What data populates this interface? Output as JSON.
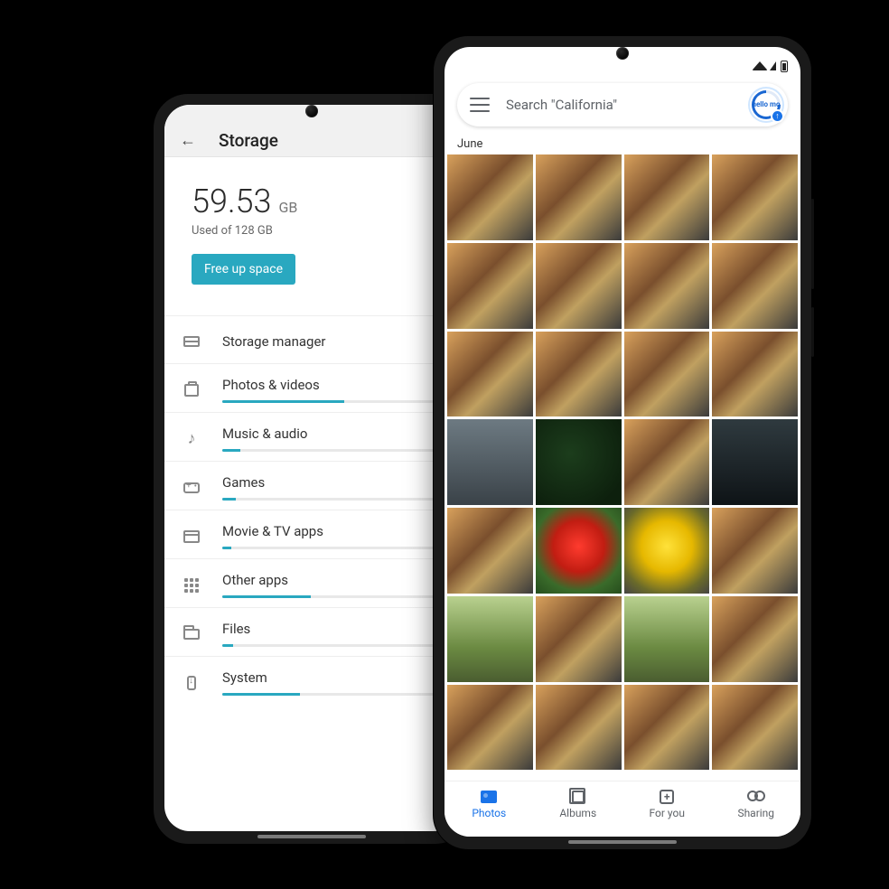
{
  "storage": {
    "title": "Storage",
    "used_value": "59.53",
    "used_unit": "GB",
    "used_caption": "Used of 128 GB",
    "free_up_label": "Free up space",
    "rows": [
      {
        "id": "manager",
        "label": "Storage manager",
        "fill": 0,
        "hasBar": false
      },
      {
        "id": "photos",
        "label": "Photos & videos",
        "fill": 55,
        "hasBar": true
      },
      {
        "id": "music",
        "label": "Music & audio",
        "fill": 8,
        "hasBar": true
      },
      {
        "id": "games",
        "label": "Games",
        "fill": 6,
        "hasBar": true
      },
      {
        "id": "movie",
        "label": "Movie & TV apps",
        "fill": 4,
        "hasBar": true
      },
      {
        "id": "other",
        "label": "Other apps",
        "fill": 40,
        "hasBar": true
      },
      {
        "id": "files",
        "label": "Files",
        "fill": 5,
        "hasBar": true
      },
      {
        "id": "system",
        "label": "System",
        "fill": 35,
        "hasBar": true
      }
    ]
  },
  "photos": {
    "search_placeholder": "Search \"California\"",
    "avatar_label": "hello mo",
    "section": "June",
    "grid_count": 28,
    "thumb_classes": [
      "t-people",
      "t-people",
      "t-people",
      "t-people",
      "t-people",
      "t-people",
      "t-people",
      "t-people",
      "t-people",
      "t-people",
      "t-people",
      "t-people",
      "t-city",
      "t-leaves",
      "t-people",
      "t-dark",
      "t-people",
      "t-flowerR",
      "t-flowerY",
      "t-people",
      "t-park",
      "t-people",
      "t-park",
      "t-people",
      "t-people",
      "t-people",
      "t-people",
      "t-people"
    ],
    "nav": [
      {
        "id": "photos",
        "label": "Photos",
        "active": true
      },
      {
        "id": "albums",
        "label": "Albums",
        "active": false
      },
      {
        "id": "foryou",
        "label": "For you",
        "active": false
      },
      {
        "id": "sharing",
        "label": "Sharing",
        "active": false
      }
    ]
  }
}
